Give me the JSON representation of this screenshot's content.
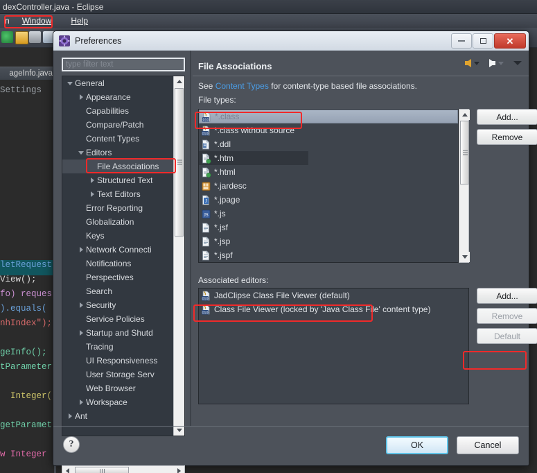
{
  "ide": {
    "window_title": "dexController.java - Eclipse",
    "menus": [
      {
        "label": "n",
        "underline": ""
      },
      {
        "label": "Window",
        "underline": "W"
      },
      {
        "label": "Help",
        "underline": "H"
      }
    ],
    "editor_tab": "ageInfo.java",
    "code_lines": [
      "Settings",
      "",
      "",
      "",
      "",
      "",
      "",
      "",
      "",
      "",
      "",
      "",
      "letRequest",
      "View();",
      "fo) reques",
      ").equals(",
      "nhIndex\");",
      "",
      "geInfo();",
      "tParameter",
      "",
      "  Integer(",
      "",
      "getParamet",
      "",
      "w Integer"
    ]
  },
  "dialog": {
    "title": "Preferences",
    "title_icon": "preferences-gear-icon",
    "window_buttons": {
      "minimize": "minimize-icon",
      "restore": "restore-icon",
      "close": "close-icon"
    },
    "filter": {
      "placeholder": "type filter text",
      "value": ""
    },
    "tree": [
      {
        "label": "General",
        "indent": 0,
        "twisty": "down",
        "selected": false
      },
      {
        "label": "Appearance",
        "indent": 1,
        "twisty": "right",
        "selected": false
      },
      {
        "label": "Capabilities",
        "indent": 1,
        "twisty": "none",
        "selected": false
      },
      {
        "label": "Compare/Patch",
        "indent": 1,
        "twisty": "none",
        "selected": false
      },
      {
        "label": "Content Types",
        "indent": 1,
        "twisty": "none",
        "selected": false
      },
      {
        "label": "Editors",
        "indent": 1,
        "twisty": "down",
        "selected": false
      },
      {
        "label": "File Associations",
        "indent": 2,
        "twisty": "none",
        "selected": true
      },
      {
        "label": "Structured Text",
        "indent": 2,
        "twisty": "right",
        "selected": false
      },
      {
        "label": "Text Editors",
        "indent": 2,
        "twisty": "right",
        "selected": false
      },
      {
        "label": "Error Reporting",
        "indent": 1,
        "twisty": "none",
        "selected": false
      },
      {
        "label": "Globalization",
        "indent": 1,
        "twisty": "none",
        "selected": false
      },
      {
        "label": "Keys",
        "indent": 1,
        "twisty": "none",
        "selected": false
      },
      {
        "label": "Network Connecti",
        "indent": 1,
        "twisty": "right",
        "selected": false
      },
      {
        "label": "Notifications",
        "indent": 1,
        "twisty": "none",
        "selected": false
      },
      {
        "label": "Perspectives",
        "indent": 1,
        "twisty": "none",
        "selected": false
      },
      {
        "label": "Search",
        "indent": 1,
        "twisty": "none",
        "selected": false
      },
      {
        "label": "Security",
        "indent": 1,
        "twisty": "right",
        "selected": false
      },
      {
        "label": "Service Policies",
        "indent": 1,
        "twisty": "none",
        "selected": false
      },
      {
        "label": "Startup and Shutd",
        "indent": 1,
        "twisty": "right",
        "selected": false
      },
      {
        "label": "Tracing",
        "indent": 1,
        "twisty": "none",
        "selected": false
      },
      {
        "label": "UI Responsiveness",
        "indent": 1,
        "twisty": "none",
        "selected": false
      },
      {
        "label": "User Storage Serv",
        "indent": 1,
        "twisty": "none",
        "selected": false
      },
      {
        "label": "Web Browser",
        "indent": 1,
        "twisty": "none",
        "selected": false
      },
      {
        "label": "Workspace",
        "indent": 1,
        "twisty": "right",
        "selected": false
      },
      {
        "label": "Ant",
        "indent": 0,
        "twisty": "right",
        "selected": false
      }
    ],
    "page": {
      "title": "File Associations",
      "nav": {
        "back": "back-arrow-icon",
        "back_menu": "chevron-down-icon",
        "forward": "forward-arrow-icon",
        "forward_menu": "chevron-down-icon",
        "view_menu": "chevron-down-icon"
      },
      "description_prefix": "See ",
      "description_link": "Content Types",
      "description_suffix": " for content-type based file associations.",
      "file_types_label": "File types:",
      "file_types": [
        {
          "name": "*.class",
          "icon": "class-file-icon",
          "state": "selected"
        },
        {
          "name": "*.class without source",
          "icon": "class-nosource-icon",
          "state": "normal"
        },
        {
          "name": "*.ddl",
          "icon": "ddl-file-icon",
          "state": "normal"
        },
        {
          "name": "*.htm",
          "icon": "html-file-icon",
          "state": "highlight"
        },
        {
          "name": "*.html",
          "icon": "html-file-icon",
          "state": "normal"
        },
        {
          "name": "*.jardesc",
          "icon": "jardesc-file-icon",
          "state": "normal"
        },
        {
          "name": "*.jpage",
          "icon": "jpage-file-icon",
          "state": "normal"
        },
        {
          "name": "*.js",
          "icon": "js-file-icon",
          "state": "normal"
        },
        {
          "name": "*.jsf",
          "icon": "text-file-icon",
          "state": "normal"
        },
        {
          "name": "*.jsp",
          "icon": "text-file-icon",
          "state": "normal"
        },
        {
          "name": "*.jspf",
          "icon": "text-file-icon",
          "state": "normal"
        }
      ],
      "file_type_buttons": [
        {
          "label": "Add...",
          "enabled": true
        },
        {
          "label": "Remove",
          "enabled": true
        }
      ],
      "associated_editors_label": "Associated editors:",
      "associated_editors": [
        {
          "name": "JadClipse Class File Viewer (default)",
          "icon": "jadclipse-editor-icon"
        },
        {
          "name": "Class File Viewer (locked by 'Java Class File' content type)",
          "icon": "class-editor-icon"
        }
      ],
      "editor_buttons": [
        {
          "label": "Add...",
          "enabled": true
        },
        {
          "label": "Remove",
          "enabled": false
        },
        {
          "label": "Default",
          "enabled": false
        }
      ]
    },
    "footer": {
      "help": "?",
      "ok": "OK",
      "cancel": "Cancel"
    }
  },
  "annotations": {
    "highlight_color": "#f02a2a",
    "boxes": [
      "window-menu-highlight",
      "file-associations-tree-highlight",
      "class-filetype-highlight",
      "jadclipse-editor-highlight",
      "default-button-highlight"
    ]
  }
}
